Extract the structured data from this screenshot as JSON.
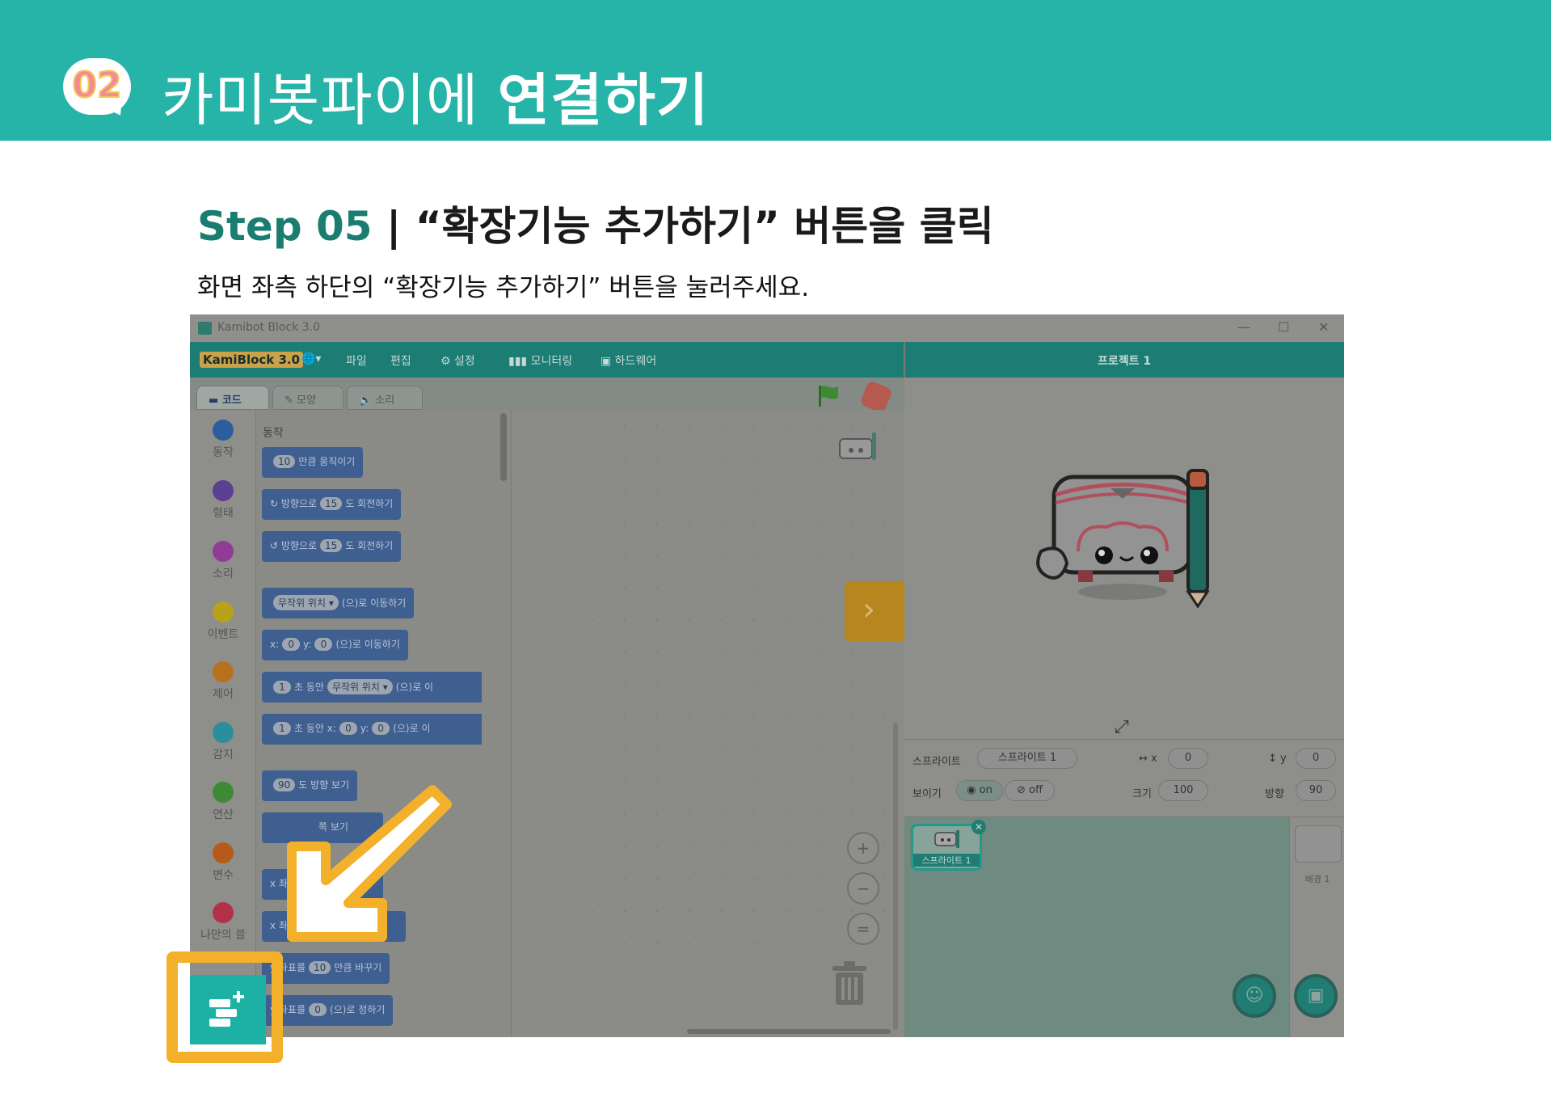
{
  "banner": {
    "badge_number": "02",
    "title_regular": "카미봇파이에 ",
    "title_bold": "연결하기"
  },
  "step": {
    "label": "Step 05",
    "separator": " | ",
    "title": "“확장기능 추가하기” 버튼을 클릭",
    "description": "화면 좌측 하단의 “확장기능 추가하기” 버튼을 눌러주세요."
  },
  "screenshot": {
    "window_title": "Kamibot Block 3.0",
    "window_controls": [
      "—",
      "☐",
      "✕"
    ],
    "logo": "KamiBlock 3.0",
    "menu": [
      {
        "icon": "globe-icon",
        "label": "🌐▾"
      },
      {
        "label": "파일"
      },
      {
        "label": "편집"
      },
      {
        "icon": "gear-icon",
        "label": "⚙ 설정"
      },
      {
        "icon": "bar-chart-icon",
        "label": "▮▮▮ 모니터링"
      },
      {
        "icon": "chip-icon",
        "label": "▣ 하드웨어"
      }
    ],
    "project_title": "프로젝트 1",
    "tabs": [
      "코드",
      "모양",
      "소리"
    ],
    "categories": [
      {
        "label": "동작",
        "color": "#2c5e9e"
      },
      {
        "label": "형태",
        "color": "#5b3f93"
      },
      {
        "label": "소리",
        "color": "#8e3c96"
      },
      {
        "label": "이벤트",
        "color": "#b8a21c"
      },
      {
        "label": "제어",
        "color": "#b7711c"
      },
      {
        "label": "감지",
        "color": "#2a8f9b"
      },
      {
        "label": "연산",
        "color": "#3c8a33"
      },
      {
        "label": "변수",
        "color": "#b65a1c"
      },
      {
        "label": "나만의 블",
        "color": "#b23148"
      }
    ],
    "palette_heading": "동작",
    "blocks": {
      "move": {
        "value": "10",
        "text": "만큼 움직이기"
      },
      "turn_right": {
        "prefix": "↻ 방향으로",
        "value": "15",
        "text": "도 회전하기"
      },
      "turn_left": {
        "prefix": "↺ 방향으로",
        "value": "15",
        "text": "도 회전하기"
      },
      "goto": {
        "value": "무작위 위치 ▾",
        "text": "(으)로 이동하기"
      },
      "goto_xy": {
        "x_label": "x:",
        "x": "0",
        "y_label": "y:",
        "y": "0",
        "text": "(으)로 이동하기"
      },
      "glide": {
        "value": "1",
        "mid": "초 동안",
        "target": "무작위 위치 ▾",
        "text": "(으)로 이"
      },
      "glide_xy": {
        "value": "1",
        "mid": "초 동안 x:",
        "x": "0",
        "y_label": "y:",
        "y": "0",
        "text": "(으)로 이"
      },
      "point": {
        "value": "90",
        "text": "도 방향 보기"
      },
      "point_towards": {
        "text": "쪽 보기"
      },
      "change_x": {
        "text": "x 좌표"
      },
      "set_x": {
        "text": "x 좌표"
      },
      "change_y": {
        "prefix": "y 좌표를",
        "value": "10",
        "text": "만큼 바꾸기"
      },
      "set_y": {
        "prefix": "y 좌표를",
        "value": "0",
        "text": "(으)로 정하기"
      }
    },
    "sprite_info": {
      "sprite_label": "스프라이트",
      "sprite_name": "스프라이트 1",
      "x_label": "↔ x",
      "x_value": "0",
      "y_label": "↕ y",
      "y_value": "0",
      "show_label": "보이기",
      "on_label": "on",
      "off_label": "off",
      "size_label": "크기",
      "size_value": "100",
      "direction_label": "방향",
      "direction_value": "90"
    },
    "sprite_card_label": "스프라이트 1",
    "backdrop_label": "배경 1"
  }
}
